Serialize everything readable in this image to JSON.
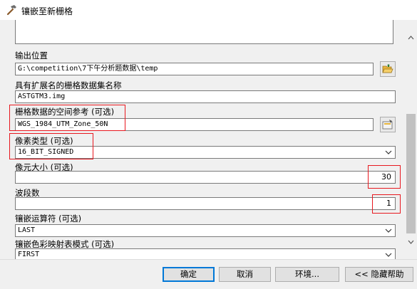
{
  "window": {
    "title": "镶嵌至新栅格",
    "icon": "hammer-icon"
  },
  "fields": {
    "output_location": {
      "label": "输出位置",
      "value": "G:\\competition\\7下午分析题数据\\temp"
    },
    "raster_name": {
      "label": "具有扩展名的栅格数据集名称",
      "value": "ASTGTM3.img"
    },
    "spatial_reference": {
      "label": "栅格数据的空间参考 (可选)",
      "value": "WGS_1984_UTM_Zone_50N"
    },
    "pixel_type": {
      "label": "像素类型 (可选)",
      "value": "16_BIT_SIGNED"
    },
    "cell_size": {
      "label": "像元大小 (可选)",
      "value": "30"
    },
    "band_count": {
      "label": "波段数",
      "value": "1"
    },
    "mosaic_operator": {
      "label": "镶嵌运算符 (可选)",
      "value": "LAST"
    },
    "colormap_mode": {
      "label": "镶嵌色彩映射表模式 (可选)",
      "value": "FIRST"
    }
  },
  "buttons": {
    "ok": "确定",
    "cancel": "取消",
    "environments": "环境...",
    "hide_help": "<< 隐藏帮助"
  },
  "colors": {
    "highlight_box": "#e8181f",
    "primary_border": "#0078d7"
  }
}
